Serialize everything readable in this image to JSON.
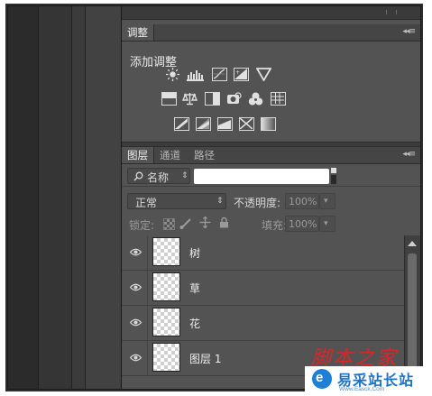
{
  "adjustments_panel": {
    "tab_label": "调整",
    "add_adjustment_label": "添加调整",
    "icons_row1": [
      "brightness-contrast-icon",
      "levels-icon",
      "curves-icon",
      "exposure-icon",
      "gradient-map-triangle-icon"
    ],
    "icons_row2": [
      "hue-saturation-icon",
      "color-balance-icon",
      "black-white-icon",
      "photo-filter-icon",
      "channel-mixer-icon",
      "color-lookup-icon"
    ],
    "icons_row3": [
      "invert-icon",
      "posterize-icon",
      "threshold-icon",
      "selective-color-icon",
      "gradient-fill-icon"
    ]
  },
  "layers_panel": {
    "tabs": [
      {
        "label": "图层",
        "active": true
      },
      {
        "label": "通道",
        "active": false
      },
      {
        "label": "路径",
        "active": false
      }
    ],
    "filter": {
      "kind_label": "名称",
      "value": ""
    },
    "blend_mode": "正常",
    "opacity_label": "不透明度:",
    "opacity_value": "100%",
    "lock_label": "锁定:",
    "fill_label": "填充:",
    "fill_value": "100%",
    "layers": [
      {
        "name": "树",
        "visible": true
      },
      {
        "name": "草",
        "visible": true
      },
      {
        "name": "花",
        "visible": true
      },
      {
        "name": "图层 1",
        "visible": true
      }
    ]
  },
  "watermark": {
    "top_text": "脚本之家",
    "site_name": "易采站长站",
    "site_url": "Www.Easck.Com"
  },
  "colors": {
    "panel_bg": "#535353",
    "tabbar_bg": "#454545",
    "workspace_dark": "#262626",
    "watermark_red": "#d9262a",
    "watermark_blue": "#1f73c6"
  }
}
